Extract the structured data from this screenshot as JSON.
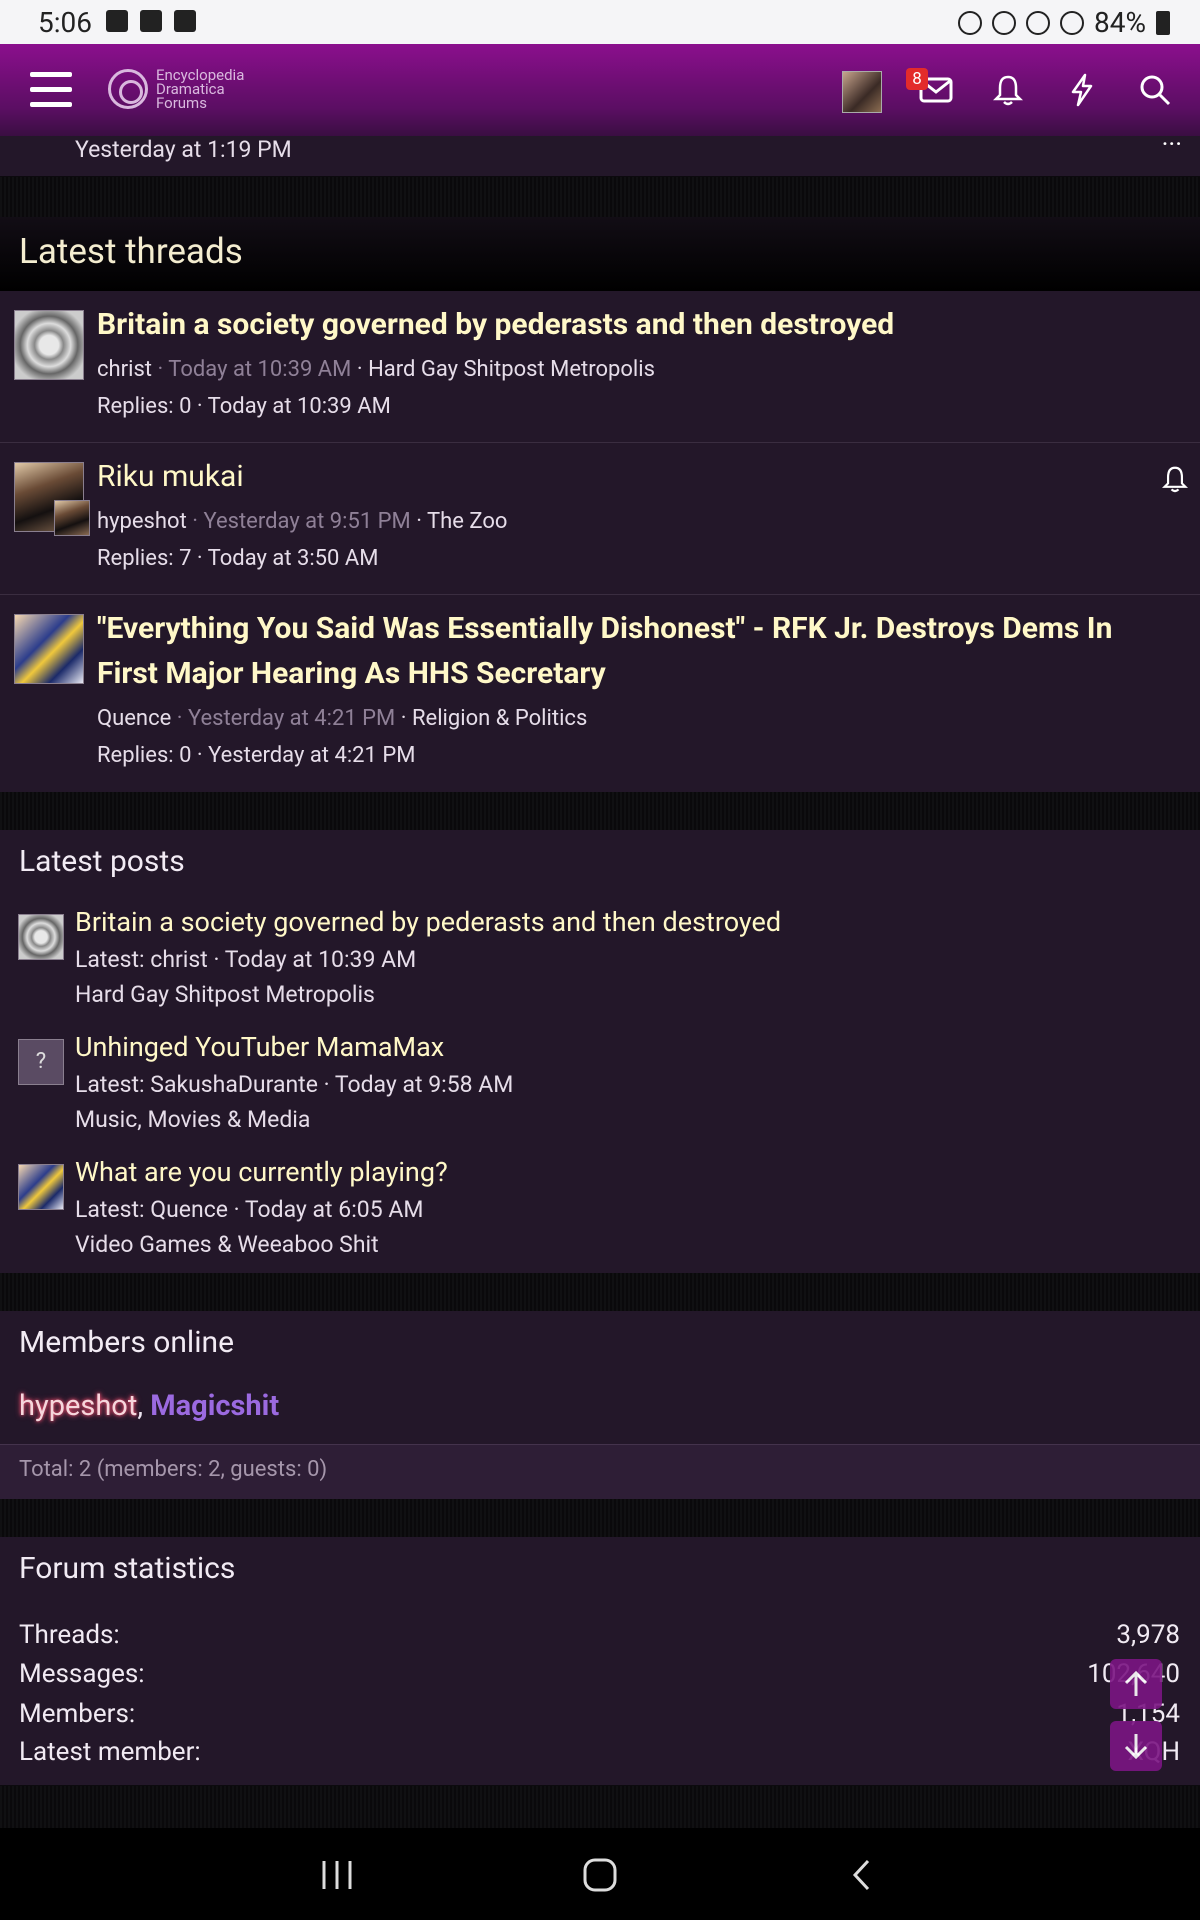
{
  "status": {
    "time": "5:06",
    "battery": "84%"
  },
  "topbar": {
    "logo_lines": [
      "Encyclopedia",
      "Dramatica",
      "Forums"
    ],
    "badge_count": "8"
  },
  "prev_item": {
    "time": "Yesterday at 1:19 PM",
    "more": "···"
  },
  "latest_threads": {
    "header": "Latest threads",
    "items": [
      {
        "title_lines": [
          "Britain a society governed by pederasts and then destroyed"
        ],
        "author": "christ",
        "started": "Today at 10:39 AM",
        "forum": "Hard Gay Shitpost Metropolis",
        "replies": "Replies: 0 · Today at 10:39 AM"
      },
      {
        "title_lines": [
          "Riku mukai"
        ],
        "author": "hypeshot",
        "started": "Yesterday at 9:51 PM",
        "forum": "The Zoo",
        "replies": "Replies: 7 · Today at 3:50 AM"
      },
      {
        "title_lines": [
          "\"Everything You Said Was Essentially Dishonest\" - RFK Jr. Destroys Dems In",
          "First Major Hearing As HHS Secretary"
        ],
        "author": "Quence",
        "started": "Yesterday at 4:21 PM",
        "forum": "Religion & Politics",
        "replies": "Replies: 0 · Yesterday at 4:21 PM"
      }
    ]
  },
  "latest_posts": {
    "header": "Latest posts",
    "items": [
      {
        "title": "Britain a society governed by pederasts and then destroyed",
        "latest": "Latest: christ · Today at 10:39 AM",
        "forum": "Hard Gay Shitpost Metropolis"
      },
      {
        "title": "Unhinged YouTuber MamaMax",
        "latest": "Latest: SakushaDurante · Today at 9:58 AM",
        "forum": "Music, Movies & Media",
        "avatar_letter": "?"
      },
      {
        "title": "What are you currently playing?",
        "latest": "Latest: Quence · Today at 6:05 AM",
        "forum": "Video Games & Weeaboo Shit"
      }
    ]
  },
  "members_online": {
    "header": "Members online",
    "member1": "hypeshot",
    "sep": ",",
    "member2": "Magicshit",
    "total": "Total: 2 (members: 2, guests: 0)"
  },
  "forum_statistics": {
    "header": "Forum statistics",
    "rows": [
      {
        "label": "Threads:",
        "value": "3,978"
      },
      {
        "label": "Messages:",
        "value": "102,640"
      },
      {
        "label": "Members:",
        "value": "1,154"
      },
      {
        "label": "Latest member:",
        "value": "XQH"
      }
    ]
  },
  "colors": {
    "accent_purple": "#7b1583",
    "title_cream": "#fff8c8",
    "panel_bg": "#231729",
    "member2": "#9b6ae0"
  }
}
